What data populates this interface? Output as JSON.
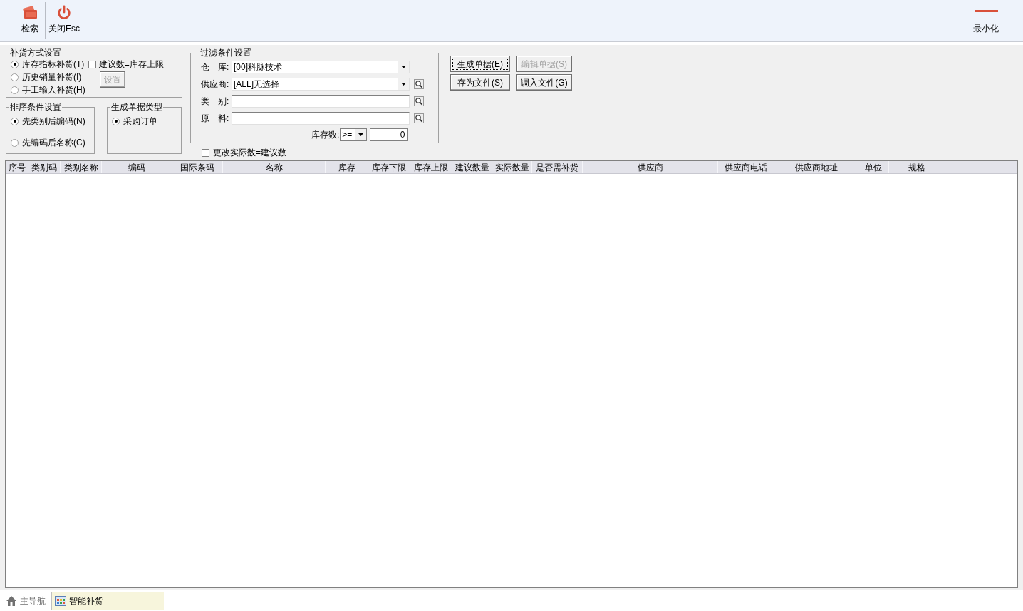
{
  "toolbar": {
    "buttons": [
      {
        "kind": "search",
        "label": "检索"
      },
      {
        "kind": "close",
        "label": "关闭Esc"
      }
    ],
    "minimize": {
      "label": "最小化"
    }
  },
  "replenish_method": {
    "title": "补货方式设置",
    "options": [
      {
        "label": "库存指标补货(T)",
        "selected": true
      },
      {
        "label": "历史销量补货(I)",
        "selected": false
      },
      {
        "label": "手工输入补货(H)",
        "selected": false
      }
    ],
    "checkbox": {
      "label": "建议数=库存上限",
      "checked": false
    },
    "settings_button": {
      "label": "设置",
      "disabled": true
    }
  },
  "sort_method": {
    "title": "排序条件设置",
    "options": [
      {
        "label": "先类别后编码(N)",
        "selected": true
      },
      {
        "label": "先编码后名称(C)",
        "selected": false
      }
    ]
  },
  "document_type": {
    "title": "生成单据类型",
    "options": [
      {
        "label": "采购订单",
        "selected": true
      }
    ]
  },
  "filter": {
    "title": "过滤条件设置",
    "fields": [
      {
        "kind": "combo",
        "label": "仓　库:",
        "value": "[00]科脉技术",
        "lookup": false
      },
      {
        "kind": "combo",
        "label": "供应商:",
        "value": "[ALL]无选择",
        "lookup": true
      },
      {
        "kind": "text",
        "label": "类　别:",
        "lookup": true
      },
      {
        "kind": "text",
        "label": "原　料:",
        "lookup": true
      }
    ],
    "stock": {
      "label": "库存数:",
      "operator": ">=",
      "value": "0"
    }
  },
  "sync_checkbox": {
    "label": "更改实际数=建议数",
    "checked": false
  },
  "actions": [
    {
      "label": "生成单据(E)",
      "disabled": false,
      "focused": true
    },
    {
      "label": "编辑单据(S)",
      "disabled": true,
      "focused": false
    },
    {
      "label": "存为文件(S)",
      "disabled": false,
      "focused": false
    },
    {
      "label": "调入文件(G)",
      "disabled": false,
      "focused": false
    }
  ],
  "table": {
    "columns": [
      {
        "label": "序号"
      },
      {
        "label": "类别码"
      },
      {
        "label": "类别名称"
      },
      {
        "label": "编码"
      },
      {
        "label": "国际条码"
      },
      {
        "label": "名称"
      },
      {
        "label": "库存"
      },
      {
        "label": "库存下限"
      },
      {
        "label": "库存上限"
      },
      {
        "label": "建议数量"
      },
      {
        "label": "实际数量"
      },
      {
        "label": "是否需补货"
      },
      {
        "label": "供应商"
      },
      {
        "label": "供应商电话"
      },
      {
        "label": "供应商地址"
      },
      {
        "label": "单位"
      },
      {
        "label": "规格"
      }
    ]
  },
  "bottom_tabs": [
    {
      "kind": "home",
      "label": "主导航",
      "selected": false
    },
    {
      "kind": "module",
      "label": "智能补货",
      "selected": true
    }
  ]
}
